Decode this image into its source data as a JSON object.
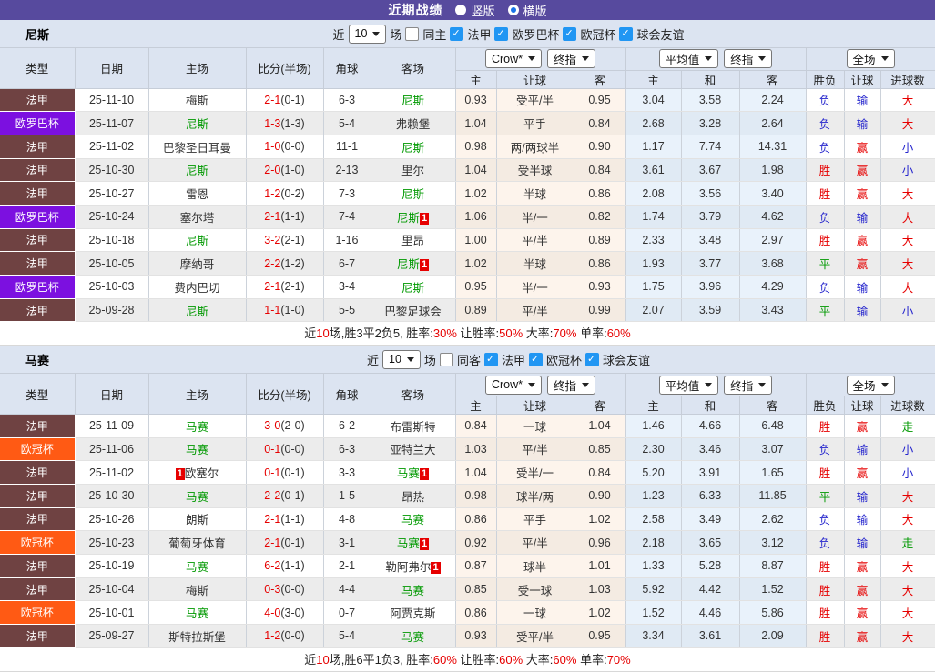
{
  "titlebar": {
    "title": "近期战绩",
    "radios": [
      {
        "label": "竖版",
        "selected": false
      },
      {
        "label": "横版",
        "selected": true
      }
    ]
  },
  "table_header": {
    "left_cols": [
      "类型",
      "日期",
      "主场",
      "比分(半场)",
      "角球",
      "客场"
    ],
    "group1_dropdowns": [
      "Crow*",
      "终指"
    ],
    "group2_dropdowns": [
      "平均值",
      "终指"
    ],
    "group3_dropdowns": [
      "全场"
    ],
    "sub_cols": [
      "主",
      "让球",
      "客",
      "主",
      "和",
      "客",
      "胜负",
      "让球",
      "进球数"
    ]
  },
  "colors": {
    "titlebar_bg": "#574a9e",
    "panel_bg": "#dce4f1",
    "ligue1_badge": "#6f4242",
    "europa_badge": "#7c10e0",
    "ucl_badge": "#ff5a14",
    "win_red": "#e60000",
    "lose_blue": "#2525cd",
    "draw_green": "#009900",
    "team_green": "#009900",
    "odds_col_bg": "#fdf4ec",
    "avg_col_bg": "#e9f2fb",
    "checkbox_blue": "#2196f3"
  },
  "sections": [
    {
      "team": "尼斯",
      "filter": {
        "prefix": "近",
        "count": "10",
        "suffix": "场",
        "same_label": "同主",
        "same_checked": false,
        "leagues": [
          {
            "label": "法甲",
            "checked": true
          },
          {
            "label": "欧罗巴杯",
            "checked": true
          },
          {
            "label": "欧冠杯",
            "checked": true
          },
          {
            "label": "球会友谊",
            "checked": true
          }
        ]
      },
      "rows": [
        {
          "league": "法甲",
          "lg": "ligue1",
          "date": "25-11-10",
          "home": "梅斯",
          "home_hl": false,
          "home_badge_before": "",
          "home_badge": "",
          "score": "2-1",
          "half": "(0-1)",
          "corner": "6-3",
          "away": "尼斯",
          "away_hl": true,
          "away_badge": "",
          "odds": [
            "0.93",
            "受平/半",
            "0.95"
          ],
          "avg": [
            "3.04",
            "3.58",
            "2.24"
          ],
          "results": [
            {
              "t": "负",
              "c": "blue"
            },
            {
              "t": "输",
              "c": "blue"
            },
            {
              "t": "大",
              "c": "red"
            }
          ]
        },
        {
          "league": "欧罗巴杯",
          "lg": "europa",
          "date": "25-11-07",
          "home": "尼斯",
          "home_hl": true,
          "home_badge_before": "",
          "home_badge": "",
          "score": "1-3",
          "half": "(1-3)",
          "corner": "5-4",
          "away": "弗赖堡",
          "away_hl": false,
          "away_badge": "",
          "odds": [
            "1.04",
            "平手",
            "0.84"
          ],
          "avg": [
            "2.68",
            "3.28",
            "2.64"
          ],
          "results": [
            {
              "t": "负",
              "c": "blue"
            },
            {
              "t": "输",
              "c": "blue"
            },
            {
              "t": "大",
              "c": "red"
            }
          ]
        },
        {
          "league": "法甲",
          "lg": "ligue1",
          "date": "25-11-02",
          "home": "巴黎圣日耳曼",
          "home_hl": false,
          "home_badge_before": "",
          "home_badge": "",
          "score": "1-0",
          "half": "(0-0)",
          "corner": "11-1",
          "away": "尼斯",
          "away_hl": true,
          "away_badge": "",
          "odds": [
            "0.98",
            "两/两球半",
            "0.90"
          ],
          "avg": [
            "1.17",
            "7.74",
            "14.31"
          ],
          "results": [
            {
              "t": "负",
              "c": "blue"
            },
            {
              "t": "赢",
              "c": "red"
            },
            {
              "t": "小",
              "c": "blue"
            }
          ]
        },
        {
          "league": "法甲",
          "lg": "ligue1",
          "date": "25-10-30",
          "home": "尼斯",
          "home_hl": true,
          "home_badge_before": "",
          "home_badge": "",
          "score": "2-0",
          "half": "(1-0)",
          "corner": "2-13",
          "away": "里尔",
          "away_hl": false,
          "away_badge": "",
          "odds": [
            "1.04",
            "受半球",
            "0.84"
          ],
          "avg": [
            "3.61",
            "3.67",
            "1.98"
          ],
          "results": [
            {
              "t": "胜",
              "c": "red"
            },
            {
              "t": "赢",
              "c": "red"
            },
            {
              "t": "小",
              "c": "blue"
            }
          ]
        },
        {
          "league": "法甲",
          "lg": "ligue1",
          "date": "25-10-27",
          "home": "雷恩",
          "home_hl": false,
          "home_badge_before": "",
          "home_badge": "",
          "score": "1-2",
          "half": "(0-2)",
          "corner": "7-3",
          "away": "尼斯",
          "away_hl": true,
          "away_badge": "",
          "odds": [
            "1.02",
            "半球",
            "0.86"
          ],
          "avg": [
            "2.08",
            "3.56",
            "3.40"
          ],
          "results": [
            {
              "t": "胜",
              "c": "red"
            },
            {
              "t": "赢",
              "c": "red"
            },
            {
              "t": "大",
              "c": "red"
            }
          ]
        },
        {
          "league": "欧罗巴杯",
          "lg": "europa",
          "date": "25-10-24",
          "home": "塞尔塔",
          "home_hl": false,
          "home_badge_before": "",
          "home_badge": "",
          "score": "2-1",
          "half": "(1-1)",
          "corner": "7-4",
          "away": "尼斯",
          "away_hl": true,
          "away_badge": "1",
          "odds": [
            "1.06",
            "半/一",
            "0.82"
          ],
          "avg": [
            "1.74",
            "3.79",
            "4.62"
          ],
          "results": [
            {
              "t": "负",
              "c": "blue"
            },
            {
              "t": "输",
              "c": "blue"
            },
            {
              "t": "大",
              "c": "red"
            }
          ]
        },
        {
          "league": "法甲",
          "lg": "ligue1",
          "date": "25-10-18",
          "home": "尼斯",
          "home_hl": true,
          "home_badge_before": "",
          "home_badge": "",
          "score": "3-2",
          "half": "(2-1)",
          "corner": "1-16",
          "away": "里昂",
          "away_hl": false,
          "away_badge": "",
          "odds": [
            "1.00",
            "平/半",
            "0.89"
          ],
          "avg": [
            "2.33",
            "3.48",
            "2.97"
          ],
          "results": [
            {
              "t": "胜",
              "c": "red"
            },
            {
              "t": "赢",
              "c": "red"
            },
            {
              "t": "大",
              "c": "red"
            }
          ]
        },
        {
          "league": "法甲",
          "lg": "ligue1",
          "date": "25-10-05",
          "home": "摩纳哥",
          "home_hl": false,
          "home_badge_before": "",
          "home_badge": "",
          "score": "2-2",
          "half": "(1-2)",
          "corner": "6-7",
          "away": "尼斯",
          "away_hl": true,
          "away_badge": "1",
          "odds": [
            "1.02",
            "半球",
            "0.86"
          ],
          "avg": [
            "1.93",
            "3.77",
            "3.68"
          ],
          "results": [
            {
              "t": "平",
              "c": "green"
            },
            {
              "t": "赢",
              "c": "red"
            },
            {
              "t": "大",
              "c": "red"
            }
          ]
        },
        {
          "league": "欧罗巴杯",
          "lg": "europa",
          "date": "25-10-03",
          "home": "费内巴切",
          "home_hl": false,
          "home_badge_before": "",
          "home_badge": "",
          "score": "2-1",
          "half": "(2-1)",
          "corner": "3-4",
          "away": "尼斯",
          "away_hl": true,
          "away_badge": "",
          "odds": [
            "0.95",
            "半/一",
            "0.93"
          ],
          "avg": [
            "1.75",
            "3.96",
            "4.29"
          ],
          "results": [
            {
              "t": "负",
              "c": "blue"
            },
            {
              "t": "输",
              "c": "blue"
            },
            {
              "t": "大",
              "c": "red"
            }
          ]
        },
        {
          "league": "法甲",
          "lg": "ligue1",
          "date": "25-09-28",
          "home": "尼斯",
          "home_hl": true,
          "home_badge_before": "",
          "home_badge": "",
          "score": "1-1",
          "half": "(1-0)",
          "corner": "5-5",
          "away": "巴黎足球会",
          "away_hl": false,
          "away_badge": "",
          "odds": [
            "0.89",
            "平/半",
            "0.99"
          ],
          "avg": [
            "2.07",
            "3.59",
            "3.43"
          ],
          "results": [
            {
              "t": "平",
              "c": "green"
            },
            {
              "t": "输",
              "c": "blue"
            },
            {
              "t": "小",
              "c": "blue"
            }
          ]
        }
      ],
      "summary": [
        {
          "t": "近",
          "c": "k"
        },
        {
          "t": "10",
          "c": "r"
        },
        {
          "t": "场,胜3平2负5, 胜率:",
          "c": "k"
        },
        {
          "t": "30%",
          "c": "r"
        },
        {
          "t": " 让胜率:",
          "c": "k"
        },
        {
          "t": "50%",
          "c": "r"
        },
        {
          "t": " 大率:",
          "c": "k"
        },
        {
          "t": "70%",
          "c": "r"
        },
        {
          "t": " 单率:",
          "c": "k"
        },
        {
          "t": "60%",
          "c": "r"
        }
      ]
    },
    {
      "team": "马赛",
      "filter": {
        "prefix": "近",
        "count": "10",
        "suffix": "场",
        "same_label": "同客",
        "same_checked": false,
        "leagues": [
          {
            "label": "法甲",
            "checked": true
          },
          {
            "label": "欧冠杯",
            "checked": true
          },
          {
            "label": "球会友谊",
            "checked": true
          }
        ]
      },
      "rows": [
        {
          "league": "法甲",
          "lg": "ligue1",
          "date": "25-11-09",
          "home": "马赛",
          "home_hl": true,
          "home_badge_before": "",
          "home_badge": "",
          "score": "3-0",
          "half": "(2-0)",
          "corner": "6-2",
          "away": "布雷斯特",
          "away_hl": false,
          "away_badge": "",
          "odds": [
            "0.84",
            "一球",
            "1.04"
          ],
          "avg": [
            "1.46",
            "4.66",
            "6.48"
          ],
          "results": [
            {
              "t": "胜",
              "c": "red"
            },
            {
              "t": "赢",
              "c": "red"
            },
            {
              "t": "走",
              "c": "green"
            }
          ]
        },
        {
          "league": "欧冠杯",
          "lg": "ucl",
          "date": "25-11-06",
          "home": "马赛",
          "home_hl": true,
          "home_badge_before": "",
          "home_badge": "",
          "score": "0-1",
          "half": "(0-0)",
          "corner": "6-3",
          "away": "亚特兰大",
          "away_hl": false,
          "away_badge": "",
          "odds": [
            "1.03",
            "平/半",
            "0.85"
          ],
          "avg": [
            "2.30",
            "3.46",
            "3.07"
          ],
          "results": [
            {
              "t": "负",
              "c": "blue"
            },
            {
              "t": "输",
              "c": "blue"
            },
            {
              "t": "小",
              "c": "blue"
            }
          ]
        },
        {
          "league": "法甲",
          "lg": "ligue1",
          "date": "25-11-02",
          "home": "欧塞尔",
          "home_hl": false,
          "home_badge_before": "1",
          "home_badge": "",
          "score": "0-1",
          "half": "(0-1)",
          "corner": "3-3",
          "away": "马赛",
          "away_hl": true,
          "away_badge": "1",
          "odds": [
            "1.04",
            "受半/一",
            "0.84"
          ],
          "avg": [
            "5.20",
            "3.91",
            "1.65"
          ],
          "results": [
            {
              "t": "胜",
              "c": "red"
            },
            {
              "t": "赢",
              "c": "red"
            },
            {
              "t": "小",
              "c": "blue"
            }
          ]
        },
        {
          "league": "法甲",
          "lg": "ligue1",
          "date": "25-10-30",
          "home": "马赛",
          "home_hl": true,
          "home_badge_before": "",
          "home_badge": "",
          "score": "2-2",
          "half": "(0-1)",
          "corner": "1-5",
          "away": "昂热",
          "away_hl": false,
          "away_badge": "",
          "odds": [
            "0.98",
            "球半/两",
            "0.90"
          ],
          "avg": [
            "1.23",
            "6.33",
            "11.85"
          ],
          "results": [
            {
              "t": "平",
              "c": "green"
            },
            {
              "t": "输",
              "c": "blue"
            },
            {
              "t": "大",
              "c": "red"
            }
          ]
        },
        {
          "league": "法甲",
          "lg": "ligue1",
          "date": "25-10-26",
          "home": "朗斯",
          "home_hl": false,
          "home_badge_before": "",
          "home_badge": "",
          "score": "2-1",
          "half": "(1-1)",
          "corner": "4-8",
          "away": "马赛",
          "away_hl": true,
          "away_badge": "",
          "odds": [
            "0.86",
            "平手",
            "1.02"
          ],
          "avg": [
            "2.58",
            "3.49",
            "2.62"
          ],
          "results": [
            {
              "t": "负",
              "c": "blue"
            },
            {
              "t": "输",
              "c": "blue"
            },
            {
              "t": "大",
              "c": "red"
            }
          ]
        },
        {
          "league": "欧冠杯",
          "lg": "ucl",
          "date": "25-10-23",
          "home": "葡萄牙体育",
          "home_hl": false,
          "home_badge_before": "",
          "home_badge": "",
          "score": "2-1",
          "half": "(0-1)",
          "corner": "3-1",
          "away": "马赛",
          "away_hl": true,
          "away_badge": "1",
          "odds": [
            "0.92",
            "平/半",
            "0.96"
          ],
          "avg": [
            "2.18",
            "3.65",
            "3.12"
          ],
          "results": [
            {
              "t": "负",
              "c": "blue"
            },
            {
              "t": "输",
              "c": "blue"
            },
            {
              "t": "走",
              "c": "green"
            }
          ]
        },
        {
          "league": "法甲",
          "lg": "ligue1",
          "date": "25-10-19",
          "home": "马赛",
          "home_hl": true,
          "home_badge_before": "",
          "home_badge": "",
          "score": "6-2",
          "half": "(1-1)",
          "corner": "2-1",
          "away": "勒阿弗尔",
          "away_hl": false,
          "away_badge": "1",
          "odds": [
            "0.87",
            "球半",
            "1.01"
          ],
          "avg": [
            "1.33",
            "5.28",
            "8.87"
          ],
          "results": [
            {
              "t": "胜",
              "c": "red"
            },
            {
              "t": "赢",
              "c": "red"
            },
            {
              "t": "大",
              "c": "red"
            }
          ]
        },
        {
          "league": "法甲",
          "lg": "ligue1",
          "date": "25-10-04",
          "home": "梅斯",
          "home_hl": false,
          "home_badge_before": "",
          "home_badge": "",
          "score": "0-3",
          "half": "(0-0)",
          "corner": "4-4",
          "away": "马赛",
          "away_hl": true,
          "away_badge": "",
          "odds": [
            "0.85",
            "受一球",
            "1.03"
          ],
          "avg": [
            "5.92",
            "4.42",
            "1.52"
          ],
          "results": [
            {
              "t": "胜",
              "c": "red"
            },
            {
              "t": "赢",
              "c": "red"
            },
            {
              "t": "大",
              "c": "red"
            }
          ]
        },
        {
          "league": "欧冠杯",
          "lg": "ucl",
          "date": "25-10-01",
          "home": "马赛",
          "home_hl": true,
          "home_badge_before": "",
          "home_badge": "",
          "score": "4-0",
          "half": "(3-0)",
          "corner": "0-7",
          "away": "阿贾克斯",
          "away_hl": false,
          "away_badge": "",
          "odds": [
            "0.86",
            "一球",
            "1.02"
          ],
          "avg": [
            "1.52",
            "4.46",
            "5.86"
          ],
          "results": [
            {
              "t": "胜",
              "c": "red"
            },
            {
              "t": "赢",
              "c": "red"
            },
            {
              "t": "大",
              "c": "red"
            }
          ]
        },
        {
          "league": "法甲",
          "lg": "ligue1",
          "date": "25-09-27",
          "home": "斯特拉斯堡",
          "home_hl": false,
          "home_badge_before": "",
          "home_badge": "",
          "score": "1-2",
          "half": "(0-0)",
          "corner": "5-4",
          "away": "马赛",
          "away_hl": true,
          "away_badge": "",
          "odds": [
            "0.93",
            "受平/半",
            "0.95"
          ],
          "avg": [
            "3.34",
            "3.61",
            "2.09"
          ],
          "results": [
            {
              "t": "胜",
              "c": "red"
            },
            {
              "t": "赢",
              "c": "red"
            },
            {
              "t": "大",
              "c": "red"
            }
          ]
        }
      ],
      "summary": [
        {
          "t": "近",
          "c": "k"
        },
        {
          "t": "10",
          "c": "r"
        },
        {
          "t": "场,胜6平1负3, 胜率:",
          "c": "k"
        },
        {
          "t": "60%",
          "c": "r"
        },
        {
          "t": " 让胜率:",
          "c": "k"
        },
        {
          "t": "60%",
          "c": "r"
        },
        {
          "t": " 大率:",
          "c": "k"
        },
        {
          "t": "60%",
          "c": "r"
        },
        {
          "t": " 单率:",
          "c": "k"
        },
        {
          "t": "70%",
          "c": "r"
        }
      ]
    }
  ]
}
